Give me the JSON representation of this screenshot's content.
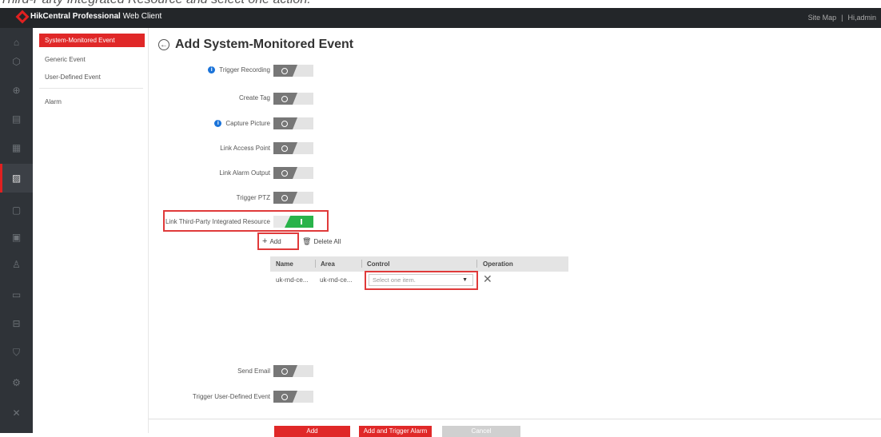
{
  "caption": "Third-Party Integrated Resource and select one action.",
  "app": {
    "title_bold": "HikCentral Professional",
    "title_rest": " Web Client",
    "site_map": "Site Map",
    "separator": "|",
    "user": "Hi,admin"
  },
  "iconbar": [
    "home-icon",
    "cube-icon",
    "globe-icon",
    "monitor-icon",
    "list-icon",
    "event-config-icon",
    "document-icon",
    "calendar-icon",
    "person-icon",
    "id-card-icon",
    "vehicle-icon",
    "shield-icon",
    "gear-icon",
    "tools-icon"
  ],
  "sidebar": {
    "items": [
      {
        "label": "System-Monitored Event"
      },
      {
        "label": "Generic Event"
      },
      {
        "label": "User-Defined Event"
      },
      {
        "label": "Alarm"
      }
    ]
  },
  "page": {
    "title": "Add System-Monitored Event"
  },
  "linkage": {
    "trigger_recording": "Trigger Recording",
    "create_tag": "Create Tag",
    "capture_picture": "Capture Picture",
    "link_access_point": "Link Access Point",
    "link_alarm_output": "Link Alarm Output",
    "trigger_ptz": "Trigger PTZ",
    "link_third_party": "Link Third-Party Integrated Resource",
    "send_email": "Send Email",
    "trigger_user_defined": "Trigger User-Defined Event"
  },
  "resource_actions": {
    "add": "Add",
    "delete_all": "Delete All"
  },
  "table": {
    "columns": [
      "Name",
      "Area",
      "Control",
      "Operation"
    ],
    "rows": [
      {
        "name": "uk-rnd-ce...",
        "area": "uk-rnd-ce...",
        "control_placeholder": "Select one item."
      }
    ]
  },
  "footer": {
    "add": "Add",
    "add_trigger": "Add and Trigger Alarm",
    "cancel": "Cancel"
  },
  "colors": {
    "accent": "#e02828",
    "toggle_on": "#28b34a",
    "topbar": "#232629"
  }
}
